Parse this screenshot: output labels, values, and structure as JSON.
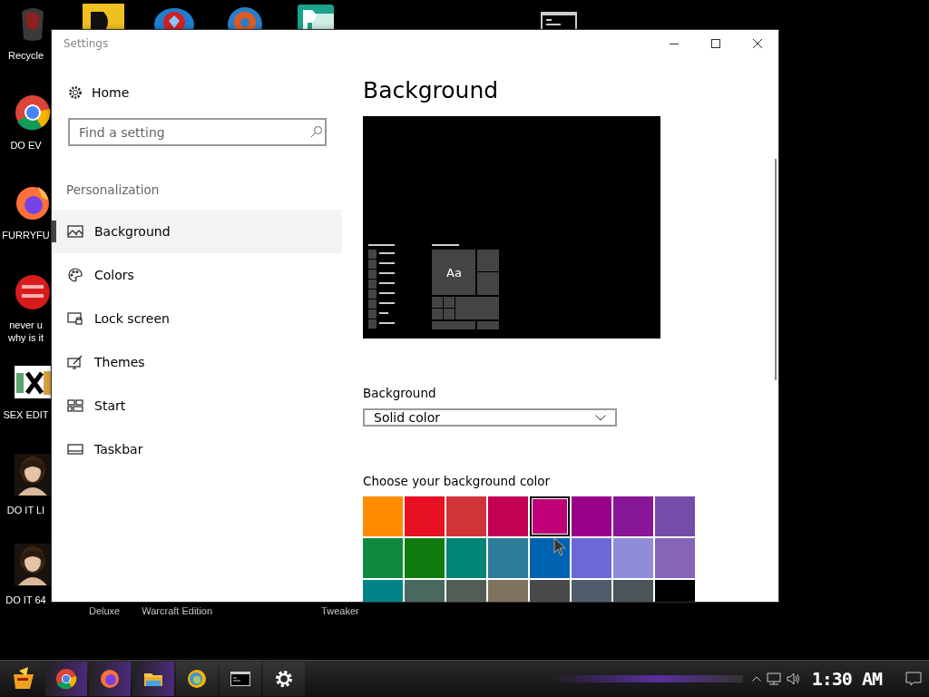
{
  "desktop": {
    "left_icons": [
      {
        "kind": "recycle",
        "lines": [
          "Recycle"
        ]
      },
      {
        "kind": "chrome",
        "lines": [
          "DO EV"
        ]
      },
      {
        "kind": "firefox",
        "lines": [
          "FURRYFU"
        ]
      },
      {
        "kind": "devcpp",
        "lines": [
          "never u",
          "why is it"
        ]
      },
      {
        "kind": "hex",
        "lines": [
          "SEX EDIT"
        ]
      },
      {
        "kind": "portrait",
        "lines": [
          "DO IT LI"
        ]
      },
      {
        "kind": "portrait",
        "lines": [
          "DO IT 64"
        ]
      }
    ],
    "top_icons": [
      {
        "kind": "yellow-app"
      },
      {
        "kind": "gem"
      },
      {
        "kind": "ring"
      },
      {
        "kind": "publisher"
      },
      {
        "kind": "console"
      }
    ],
    "bottom_labels": [
      "Deluxe",
      "Warcraft Edition",
      "Tweaker"
    ]
  },
  "window": {
    "title": "Settings",
    "sidebar": {
      "home": "Home",
      "search": {
        "placeholder": "Find a setting"
      },
      "section": "Personalization",
      "items": [
        {
          "label": "Background",
          "selected": true
        },
        {
          "label": "Colors",
          "selected": false
        },
        {
          "label": "Lock screen",
          "selected": false
        },
        {
          "label": "Themes",
          "selected": false
        },
        {
          "label": "Start",
          "selected": false
        },
        {
          "label": "Taskbar",
          "selected": false
        }
      ]
    },
    "content": {
      "title": "Background",
      "preview": {
        "tile_text": "Aa"
      },
      "background_label": "Background",
      "background_value": "Solid color",
      "color_label": "Choose your background color",
      "colors": [
        {
          "color": "#ff8c00",
          "selected": false
        },
        {
          "color": "#e81123",
          "selected": false
        },
        {
          "color": "#d13438",
          "selected": false
        },
        {
          "color": "#c30052",
          "selected": false
        },
        {
          "color": "#bf0077",
          "selected": true
        },
        {
          "color": "#9a0089",
          "selected": false
        },
        {
          "color": "#881798",
          "selected": false
        },
        {
          "color": "#744da9",
          "selected": false
        },
        {
          "color": "#10893e",
          "selected": false
        },
        {
          "color": "#107c10",
          "selected": false
        },
        {
          "color": "#018574",
          "selected": false
        },
        {
          "color": "#2d7d9a",
          "selected": false
        },
        {
          "color": "#0063b1",
          "selected": false
        },
        {
          "color": "#6b69d6",
          "selected": false
        },
        {
          "color": "#8e8cd8",
          "selected": false
        },
        {
          "color": "#8764b8",
          "selected": false
        },
        {
          "color": "#038387",
          "selected": false
        },
        {
          "color": "#486860",
          "selected": false
        },
        {
          "color": "#525e54",
          "selected": false
        },
        {
          "color": "#7e735f",
          "selected": false
        },
        {
          "color": "#4c4a48",
          "selected": false
        },
        {
          "color": "#515c6b",
          "selected": false
        },
        {
          "color": "#4a5459",
          "selected": false
        },
        {
          "color": "#000000",
          "selected": false
        }
      ]
    }
  },
  "taskbar": {
    "apps": [
      {
        "kind": "chrome"
      },
      {
        "kind": "firefox"
      },
      {
        "kind": "folder"
      },
      {
        "kind": "edge"
      },
      {
        "kind": "console"
      },
      {
        "kind": "settings"
      }
    ],
    "clock": "1:30 AM"
  }
}
